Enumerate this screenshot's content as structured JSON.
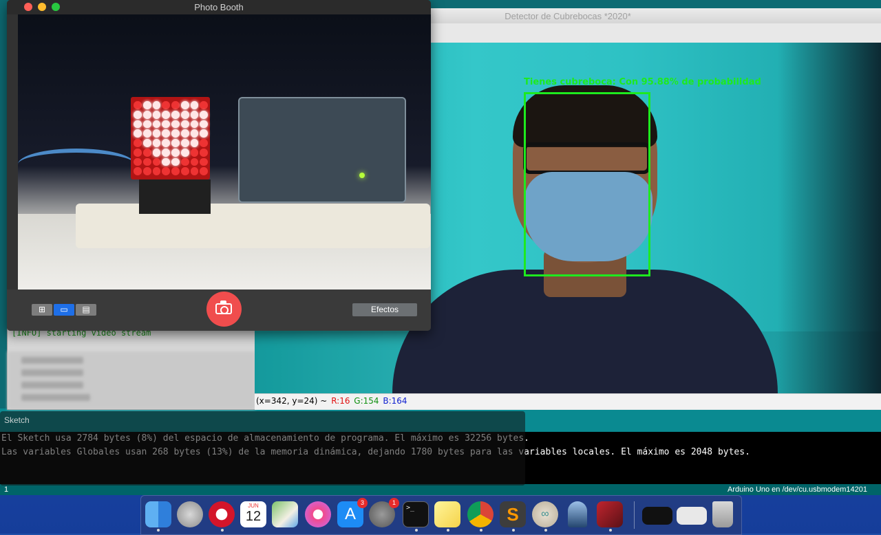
{
  "photo_booth": {
    "title": "Photo Booth",
    "effects_label": "Efectos",
    "view_buttons": [
      "grid-view",
      "single-view",
      "filmstrip-view"
    ]
  },
  "detector": {
    "title": "Detector de Cubrebocas *2020*",
    "face_label": "Tienes cubreboca: Con 95.88% de probabilidad",
    "pixel_info": {
      "pos": "(x=342, y=24) ~",
      "r": "R:16",
      "g": "G:154",
      "b": "B:164"
    }
  },
  "terminal": {
    "info_line": "[INFO] starting video stream"
  },
  "arduino": {
    "sketch_label": "Sketch",
    "console_line1": "El Sketch usa 2784 bytes (8%) del espacio de almacenamiento de programa. El máximo es 32256 bytes.",
    "console_line2": "Las variables Globales usan 268 bytes (13%) de la memoria dinámica, dejando 1780 bytes para las variables locales. El máximo es 2048 bytes.",
    "status_line_number": "1",
    "status_board": "Arduino Uno en /dev/cu.usbmodem14201"
  },
  "dock": {
    "calendar_month": "JUN",
    "calendar_day": "12",
    "app_store_badge": "3",
    "system_prefs_badge": "1",
    "apps": [
      "finder",
      "launchpad",
      "opera",
      "calendar",
      "maps",
      "itunes",
      "app-store",
      "system-preferences",
      "terminal",
      "stickies",
      "chrome",
      "sublime-text",
      "arduino",
      "pencil",
      "photo-booth",
      "window-1",
      "window-2",
      "trash"
    ]
  }
}
